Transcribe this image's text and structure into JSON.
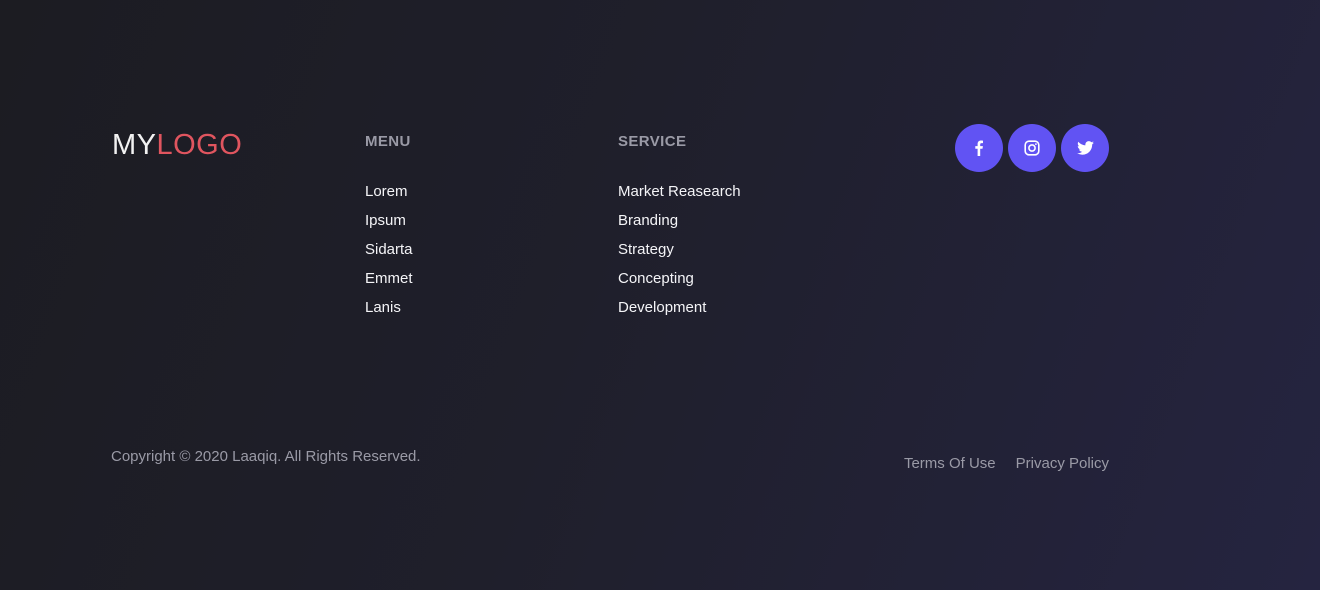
{
  "logo": {
    "part1": "MY",
    "part2": "LOGO"
  },
  "menu": {
    "title": "MENU",
    "items": [
      "Lorem",
      "Ipsum",
      "Sidarta",
      "Emmet",
      "Lanis"
    ]
  },
  "service": {
    "title": "SERVICE",
    "items": [
      "Market Reasearch",
      "Branding",
      "Strategy",
      "Concepting",
      "Development"
    ]
  },
  "social": [
    {
      "icon": "facebook-icon"
    },
    {
      "icon": "instagram-icon"
    },
    {
      "icon": "twitter-icon"
    }
  ],
  "copyright": "Copyright © 2020 Laaqiq. All Rights Reserved.",
  "legal": {
    "terms": "Terms Of Use",
    "privacy": "Privacy Policy"
  },
  "colors": {
    "accent": "#6153f3",
    "logo_accent": "#e0555f",
    "muted_text": "#9a9aa6",
    "text": "#f4f4f7"
  }
}
